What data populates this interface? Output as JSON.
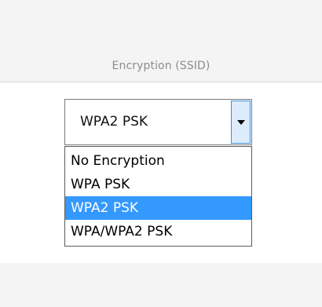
{
  "section": {
    "label": "Encryption (SSID)"
  },
  "encryption_select": {
    "selected_value": "WPA2 PSK",
    "arrow_icon": "chevron-down-icon",
    "options": [
      {
        "label": "No Encryption",
        "selected": false
      },
      {
        "label": "WPA PSK",
        "selected": false
      },
      {
        "label": "WPA2 PSK",
        "selected": true
      },
      {
        "label": "WPA/WPA2 PSK",
        "selected": false
      }
    ]
  },
  "colors": {
    "highlight": "#3399ff",
    "arrow_button_bg": "#dcecfb",
    "arrow_button_border": "#3c8fd9",
    "label_text": "#8d8d8d"
  }
}
